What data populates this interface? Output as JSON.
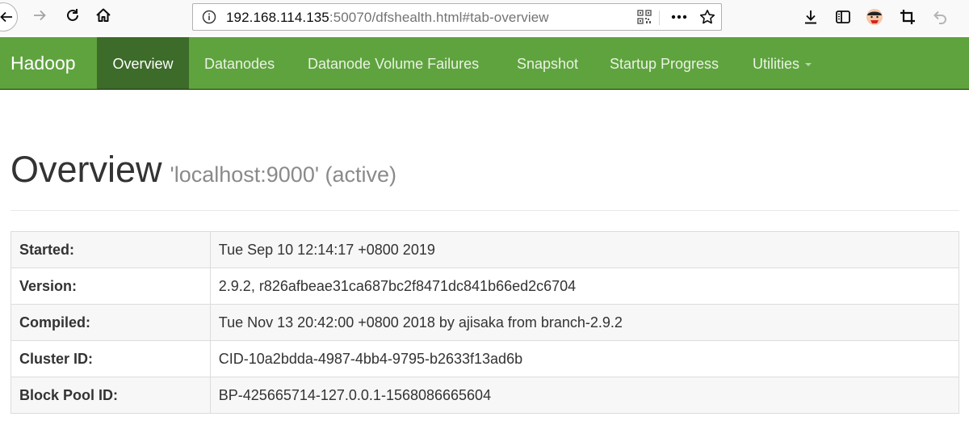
{
  "browser": {
    "url_host": "192.168.114.135",
    "url_rest": ":50070/dfshealth.html#tab-overview"
  },
  "navbar": {
    "brand": "Hadoop",
    "items": [
      {
        "label": "Overview",
        "active": true
      },
      {
        "label": "Datanodes"
      },
      {
        "label": "Datanode Volume Failures"
      },
      {
        "label": "Snapshot"
      },
      {
        "label": "Startup Progress"
      },
      {
        "label": "Utilities"
      }
    ]
  },
  "page": {
    "title": "Overview",
    "subtitle": "'localhost:9000' (active)"
  },
  "overview_table": {
    "rows": [
      {
        "key": "Started:",
        "value": "Tue Sep 10 12:14:17 +0800 2019"
      },
      {
        "key": "Version:",
        "value": "2.9.2, r826afbeae31ca687bc2f8471dc841b66ed2c6704"
      },
      {
        "key": "Compiled:",
        "value": "Tue Nov 13 20:42:00 +0800 2018 by ajisaka from branch-2.9.2"
      },
      {
        "key": "Cluster ID:",
        "value": "CID-10a2bdda-4987-4bb4-9795-b2633f13ad6b"
      },
      {
        "key": "Block Pool ID:",
        "value": "BP-425665714-127.0.0.1-1568086665604"
      }
    ]
  },
  "colors": {
    "navbar_bg": "#5fa33e",
    "navbar_active_bg": "#3d6b2a"
  }
}
